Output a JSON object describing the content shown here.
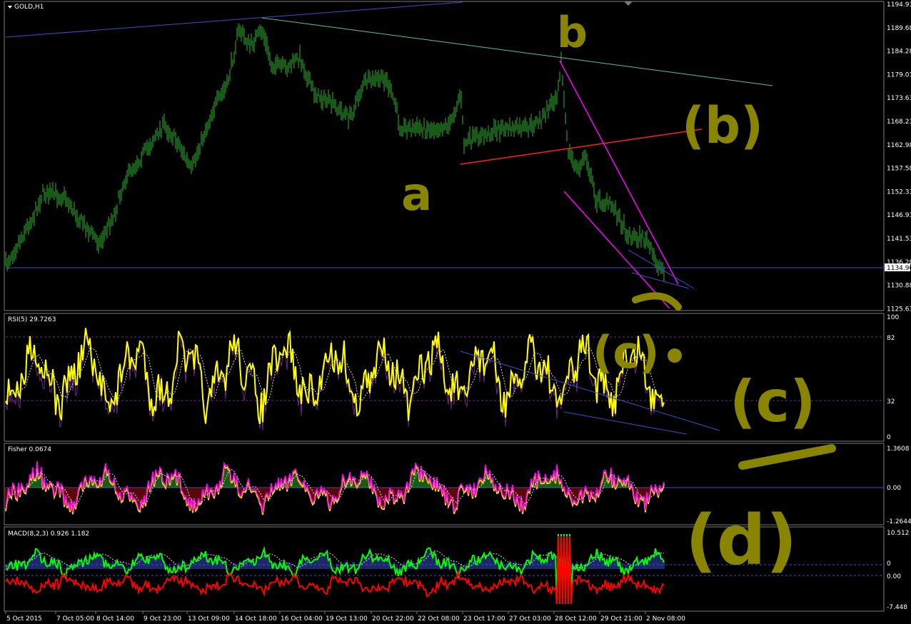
{
  "symbol_label": "GOLD,H1",
  "colors": {
    "background": "#000000",
    "candles": "#2fb52f",
    "rsi": "#ffff00",
    "rsi_signal": "#6b2a8a",
    "fisher_line_a": "#ff00ff",
    "fisher_line_b": "#ffd000",
    "fisher_hist_pos": "#2fb52f",
    "fisher_hist_neg": "#b01010",
    "macd_green": "#00ff00",
    "macd_red": "#ff0000",
    "trend_blue": "#3b4fd0",
    "trend_teal": "#5fbf9a",
    "trend_red": "#ff2020",
    "trend_magenta": "#ff00ff",
    "annotation": "#8a8500"
  },
  "main_panel": {
    "price_labels": [
      "1194.93",
      "1189.68",
      "1184.28",
      "1179.03",
      "1173.63",
      "1168.23",
      "1162.98",
      "1157.58",
      "1152.33",
      "1146.93",
      "1141.53",
      "1136.28",
      "1130.88",
      "1125.63"
    ],
    "current_price": "1134.90"
  },
  "rsi_panel": {
    "header": "RSI(5) 29.7263",
    "levels": [
      "100",
      "82",
      "32",
      "0"
    ]
  },
  "fisher_panel": {
    "header": "Fisher 0.0674",
    "levels": [
      "1.3608",
      "0.00",
      "-1.2644"
    ]
  },
  "macd_panel": {
    "header": "MACD(8,2,3) 0.926 1.182",
    "levels": [
      "10.512",
      "0",
      "0.00",
      "-7.448"
    ]
  },
  "time_axis": [
    "5 Oct 2015",
    "7 Oct 05:00",
    "8 Oct 14:00",
    "9 Oct 23:00",
    "13 Oct 09:00",
    "14 Oct 18:00",
    "16 Oct 04:00",
    "19 Oct 13:00",
    "20 Oct 22:00",
    "22 Oct 08:00",
    "23 Oct 17:00",
    "27 Oct 03:00",
    "28 Oct 12:00",
    "29 Oct 21:00",
    "2 Nov 08:00"
  ],
  "annotations": {
    "a": "a",
    "b": "b",
    "wave_b": "(b)",
    "wave_c_small": "(c)",
    "wave_c": "(c)",
    "wave_d": "(d)"
  }
}
